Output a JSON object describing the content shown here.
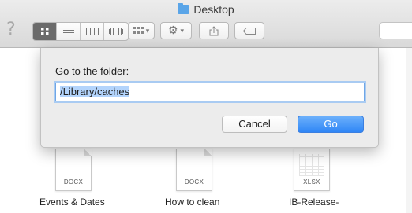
{
  "window": {
    "title": "Desktop"
  },
  "toolbar": {
    "help_glyph": "?",
    "view_modes": [
      "icon-view",
      "list-view",
      "column-view",
      "cover-flow-view"
    ],
    "active_view": "icon-view"
  },
  "files": [
    {
      "name": "Events & Dates",
      "ext": "DOCX",
      "icon": "docx-file-icon"
    },
    {
      "name": "How to clean",
      "ext": "DOCX",
      "icon": "docx-file-icon"
    },
    {
      "name": "IB-Release-",
      "ext": "XLSX",
      "icon": "xlsx-file-icon"
    }
  ],
  "dialog": {
    "label": "Go to the folder:",
    "path_value": "/Library/caches",
    "cancel_label": "Cancel",
    "go_label": "Go"
  },
  "colors": {
    "accent": "#2f86f6",
    "folder": "#5aa5e8",
    "selection": "#b3d4fc"
  }
}
